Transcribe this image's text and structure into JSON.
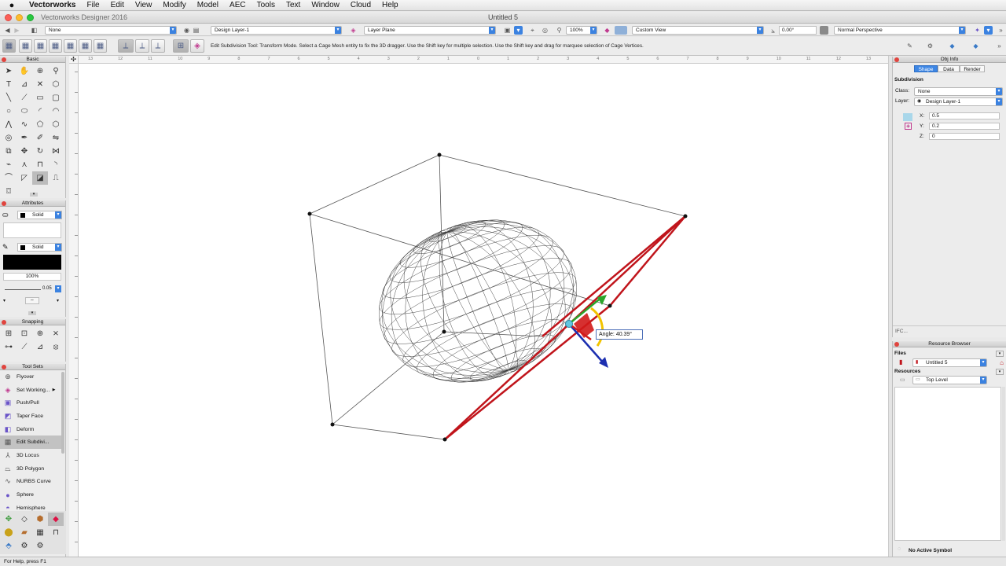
{
  "menubar": {
    "app": "Vectorworks",
    "items": [
      "File",
      "Edit",
      "View",
      "Modify",
      "Model",
      "AEC",
      "Tools",
      "Text",
      "Window",
      "Cloud",
      "Help"
    ]
  },
  "titlebar": {
    "app_title": "Vectorworks Designer 2016",
    "doc_title": "Untitled 5"
  },
  "viewbar": {
    "class": "None",
    "layer": "Design Layer-1",
    "plane": "Layer Plane",
    "zoom": "100%",
    "view": "Custom View",
    "rotation": "0.00°",
    "projection": "Normal Perspective"
  },
  "modebar": {
    "message": "Edit Subdivision Tool: Transform Mode. Select a Cage Mesh entity to fix the 3D dragger.  Use the Shift key for multiple selection.  Use the Shift key and drag for marquee selection of Cage Vertices."
  },
  "palettes": {
    "basic": "Basic",
    "attributes": {
      "title": "Attributes",
      "fill_style": "Solid",
      "pen_style": "Solid",
      "opacity": "100%",
      "line_weight": "0.05"
    },
    "snapping": "Snapping",
    "toolsets": {
      "title": "Tool Sets",
      "items": [
        {
          "label": "Flyover",
          "icon": "flyover-icon"
        },
        {
          "label": "Set Working...",
          "icon": "working-plane-icon"
        },
        {
          "label": "Push/Pull",
          "icon": "push-pull-icon"
        },
        {
          "label": "Taper Face",
          "icon": "taper-face-icon"
        },
        {
          "label": "Deform",
          "icon": "deform-icon"
        },
        {
          "label": "Edit Subdivi...",
          "icon": "edit-subdivision-icon"
        },
        {
          "label": "3D Locus",
          "icon": "locus-icon"
        },
        {
          "label": "3D Polygon",
          "icon": "polygon-3d-icon"
        },
        {
          "label": "NURBS Curve",
          "icon": "nurbs-icon"
        },
        {
          "label": "Sphere",
          "icon": "sphere-icon"
        },
        {
          "label": "Hemisphere",
          "icon": "hemisphere-icon"
        }
      ]
    }
  },
  "obj_info": {
    "title": "Obj Info",
    "tabs": [
      "Shape",
      "Data",
      "Render"
    ],
    "object_type": "Subdivision",
    "class_label": "Class:",
    "class_value": "None",
    "layer_label": "Layer:",
    "layer_value": "Design Layer-1",
    "x_label": "X:",
    "x_value": "0.5",
    "y_label": "Y:",
    "y_value": "0.2",
    "z_label": "Z:",
    "z_value": "0",
    "ifc": "IFC..."
  },
  "resource_browser": {
    "title": "Resource Browser",
    "files_label": "Files",
    "file": "Untitled 5",
    "resources_label": "Resources",
    "level": "Top Level",
    "status": "No Active Symbol"
  },
  "canvas": {
    "angle_label": "Angle:",
    "angle_value": "40.39°",
    "ruler_ticks": [
      "13",
      "12",
      "11",
      "10",
      "9",
      "8",
      "7",
      "6",
      "5",
      "4",
      "3",
      "2",
      "1",
      "0",
      "1",
      "2",
      "3",
      "4",
      "5",
      "6",
      "7",
      "8",
      "9",
      "10",
      "11",
      "12",
      "13"
    ]
  },
  "status": "For Help, press F1",
  "colors": {
    "cage_edge": "#c0141b",
    "axis_x": "#d21a1a",
    "axis_y": "#2ba52b",
    "axis_z": "#1c2fb0",
    "accent": "#3d86e4"
  }
}
